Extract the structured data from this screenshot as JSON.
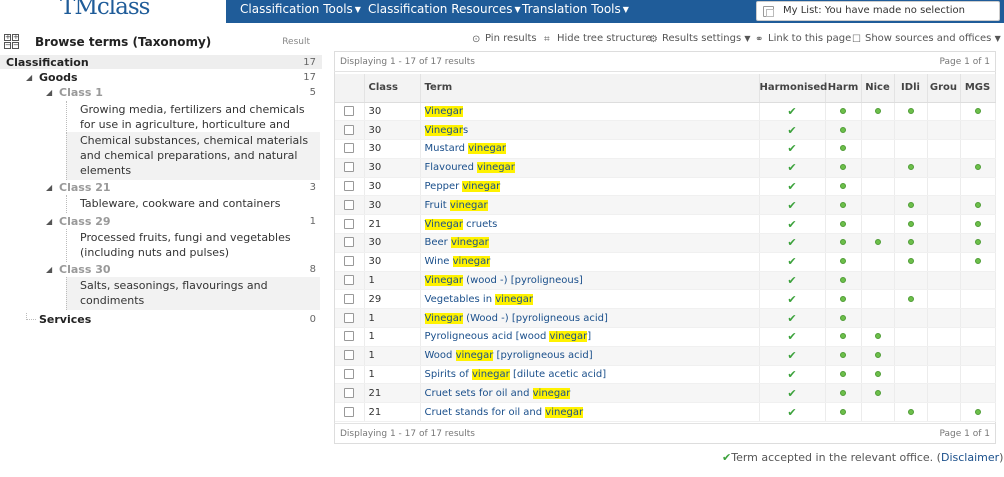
{
  "header": {
    "logo": "TMclass",
    "menu": [
      {
        "label": "Classification Tools"
      },
      {
        "label": "Classification Resources"
      },
      {
        "label": "Translation Tools"
      }
    ],
    "mylist": "My List:  You have made no selection"
  },
  "left": {
    "title": "Browse terms (Taxonomy)",
    "result_label": "Result",
    "tree": {
      "root": {
        "label": "Classification",
        "count": "17"
      },
      "goods": {
        "label": "Goods",
        "count": "17"
      },
      "class1": {
        "label": "Class 1",
        "count": "5"
      },
      "class1_leaves": [
        "Growing media, fertilizers and chemicals for use in agriculture, horticulture and forestry",
        "Chemical substances, chemical materials and chemical preparations, and natural elements"
      ],
      "class21": {
        "label": "Class 21",
        "count": "3"
      },
      "class21_leaves": [
        "Tableware, cookware and containers"
      ],
      "class29": {
        "label": "Class 29",
        "count": "1"
      },
      "class29_leaves": [
        "Processed fruits, fungi and vegetables (including nuts and pulses)"
      ],
      "class30": {
        "label": "Class 30",
        "count": "8"
      },
      "class30_leaves": [
        "Salts, seasonings, flavourings and condiments"
      ],
      "services": {
        "label": "Services",
        "count": "0"
      }
    }
  },
  "toolbar": {
    "pin": "Pin results",
    "hide_tree": "Hide tree structure",
    "settings": "Results settings",
    "link": "Link to this page",
    "show_sources": "Show sources and offices"
  },
  "pager": {
    "displaying": "Displaying 1 - 17 of 17 results",
    "page": "Page 1 of 1"
  },
  "table": {
    "headers": {
      "class": "Class",
      "term": "Term",
      "harmonised": "Harmonised",
      "harm": "Harm",
      "nice": "Nice",
      "idli": "IDli",
      "grou": "Grou",
      "mgs": "MGS"
    },
    "rows": [
      {
        "cls": "30",
        "pre": "",
        "hl": "Vinegar",
        "post": "",
        "h": true,
        "harm": true,
        "nice": true,
        "idli": true,
        "grou": false,
        "mgs": true
      },
      {
        "cls": "30",
        "pre": "",
        "hl": "Vinegar",
        "post": "s",
        "h": true,
        "harm": true,
        "nice": false,
        "idli": false,
        "grou": false,
        "mgs": false
      },
      {
        "cls": "30",
        "pre": "Mustard ",
        "hl": "vinegar",
        "post": "",
        "h": true,
        "harm": true,
        "nice": false,
        "idli": false,
        "grou": false,
        "mgs": false
      },
      {
        "cls": "30",
        "pre": "Flavoured ",
        "hl": "vinegar",
        "post": "",
        "h": true,
        "harm": true,
        "nice": false,
        "idli": true,
        "grou": false,
        "mgs": true
      },
      {
        "cls": "30",
        "pre": "Pepper ",
        "hl": "vinegar",
        "post": "",
        "h": true,
        "harm": true,
        "nice": false,
        "idli": false,
        "grou": false,
        "mgs": false
      },
      {
        "cls": "30",
        "pre": "Fruit ",
        "hl": "vinegar",
        "post": "",
        "h": true,
        "harm": true,
        "nice": false,
        "idli": true,
        "grou": false,
        "mgs": true
      },
      {
        "cls": "21",
        "pre": "",
        "hl": "Vinegar",
        "post": " cruets",
        "h": true,
        "harm": true,
        "nice": false,
        "idli": true,
        "grou": false,
        "mgs": true
      },
      {
        "cls": "30",
        "pre": "Beer ",
        "hl": "vinegar",
        "post": "",
        "h": true,
        "harm": true,
        "nice": true,
        "idli": true,
        "grou": false,
        "mgs": true
      },
      {
        "cls": "30",
        "pre": "Wine ",
        "hl": "vinegar",
        "post": "",
        "h": true,
        "harm": true,
        "nice": false,
        "idli": true,
        "grou": false,
        "mgs": true
      },
      {
        "cls": "1",
        "pre": "",
        "hl": "Vinegar",
        "post": " (wood -) [pyroligneous]",
        "h": true,
        "harm": true,
        "nice": false,
        "idli": false,
        "grou": false,
        "mgs": false
      },
      {
        "cls": "29",
        "pre": "Vegetables in ",
        "hl": "vinegar",
        "post": "",
        "h": true,
        "harm": true,
        "nice": false,
        "idli": true,
        "grou": false,
        "mgs": false
      },
      {
        "cls": "1",
        "pre": "",
        "hl": "Vinegar",
        "post": " (Wood -) [pyroligneous acid]",
        "h": true,
        "harm": true,
        "nice": false,
        "idli": false,
        "grou": false,
        "mgs": false
      },
      {
        "cls": "1",
        "pre": "Pyroligneous acid [wood ",
        "hl": "vinegar",
        "post": "]",
        "h": true,
        "harm": true,
        "nice": true,
        "idli": false,
        "grou": false,
        "mgs": false
      },
      {
        "cls": "1",
        "pre": "Wood ",
        "hl": "vinegar",
        "post": " [pyroligneous acid]",
        "h": true,
        "harm": true,
        "nice": true,
        "idli": false,
        "grou": false,
        "mgs": false
      },
      {
        "cls": "1",
        "pre": "Spirits of ",
        "hl": "vinegar",
        "post": " [dilute acetic acid]",
        "h": true,
        "harm": true,
        "nice": true,
        "idli": false,
        "grou": false,
        "mgs": false
      },
      {
        "cls": "21",
        "pre": "Cruet sets for oil and ",
        "hl": "vinegar",
        "post": "",
        "h": true,
        "harm": true,
        "nice": true,
        "idli": false,
        "grou": false,
        "mgs": false
      },
      {
        "cls": "21",
        "pre": "Cruet stands for oil and ",
        "hl": "vinegar",
        "post": "",
        "h": true,
        "harm": true,
        "nice": false,
        "idli": true,
        "grou": false,
        "mgs": true
      }
    ]
  },
  "footer": {
    "note": "Term accepted in the relevant office. (",
    "link": "Disclaimer",
    "close": ")"
  }
}
